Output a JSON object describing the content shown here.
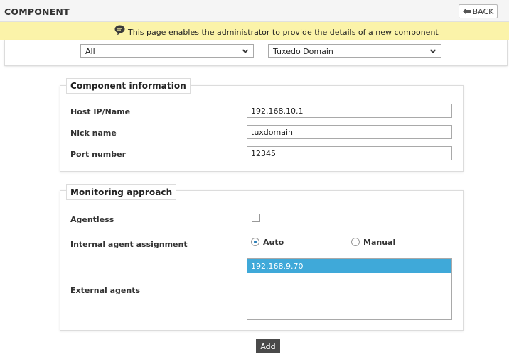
{
  "header": {
    "title": "COMPONENT",
    "back_label": "BACK"
  },
  "banner": {
    "text": "This page enables the administrator to provide the details of a new component"
  },
  "filters": {
    "category_selected": "All",
    "type_selected": "Tuxedo Domain"
  },
  "component_info": {
    "legend": "Component information",
    "fields": [
      {
        "label": "Host IP/Name",
        "value": "192.168.10.1"
      },
      {
        "label": "Nick name",
        "value": "tuxdomain"
      },
      {
        "label": "Port number",
        "value": "12345"
      }
    ]
  },
  "monitoring": {
    "legend": "Monitoring approach",
    "agentless_label": "Agentless",
    "agentless_checked": false,
    "internal_label": "Internal agent assignment",
    "options": [
      {
        "label": "Auto",
        "selected": true
      },
      {
        "label": "Manual",
        "selected": false
      }
    ],
    "external_label": "External agents",
    "external_agents": [
      "192.168.9.70"
    ]
  },
  "actions": {
    "add_label": "Add"
  },
  "colors": {
    "banner_bg": "#fbf3a9",
    "selected_item": "#3fa9d9",
    "add_button": "#4a4a4a"
  }
}
